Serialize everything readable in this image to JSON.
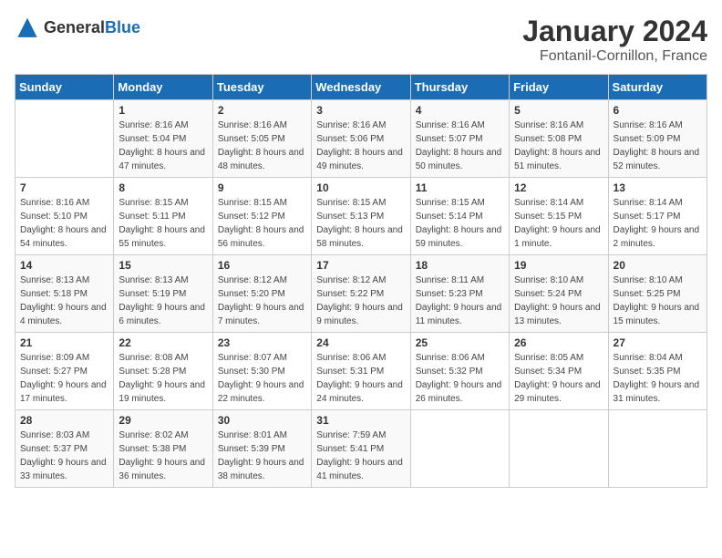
{
  "header": {
    "logo": {
      "general": "General",
      "blue": "Blue"
    },
    "title": "January 2024",
    "location": "Fontanil-Cornillon, France"
  },
  "weekdays": [
    "Sunday",
    "Monday",
    "Tuesday",
    "Wednesday",
    "Thursday",
    "Friday",
    "Saturday"
  ],
  "weeks": [
    [
      {
        "day": "",
        "sunrise": "",
        "sunset": "",
        "daylight": ""
      },
      {
        "day": "1",
        "sunrise": "Sunrise: 8:16 AM",
        "sunset": "Sunset: 5:04 PM",
        "daylight": "Daylight: 8 hours and 47 minutes."
      },
      {
        "day": "2",
        "sunrise": "Sunrise: 8:16 AM",
        "sunset": "Sunset: 5:05 PM",
        "daylight": "Daylight: 8 hours and 48 minutes."
      },
      {
        "day": "3",
        "sunrise": "Sunrise: 8:16 AM",
        "sunset": "Sunset: 5:06 PM",
        "daylight": "Daylight: 8 hours and 49 minutes."
      },
      {
        "day": "4",
        "sunrise": "Sunrise: 8:16 AM",
        "sunset": "Sunset: 5:07 PM",
        "daylight": "Daylight: 8 hours and 50 minutes."
      },
      {
        "day": "5",
        "sunrise": "Sunrise: 8:16 AM",
        "sunset": "Sunset: 5:08 PM",
        "daylight": "Daylight: 8 hours and 51 minutes."
      },
      {
        "day": "6",
        "sunrise": "Sunrise: 8:16 AM",
        "sunset": "Sunset: 5:09 PM",
        "daylight": "Daylight: 8 hours and 52 minutes."
      }
    ],
    [
      {
        "day": "7",
        "sunrise": "Sunrise: 8:16 AM",
        "sunset": "Sunset: 5:10 PM",
        "daylight": "Daylight: 8 hours and 54 minutes."
      },
      {
        "day": "8",
        "sunrise": "Sunrise: 8:15 AM",
        "sunset": "Sunset: 5:11 PM",
        "daylight": "Daylight: 8 hours and 55 minutes."
      },
      {
        "day": "9",
        "sunrise": "Sunrise: 8:15 AM",
        "sunset": "Sunset: 5:12 PM",
        "daylight": "Daylight: 8 hours and 56 minutes."
      },
      {
        "day": "10",
        "sunrise": "Sunrise: 8:15 AM",
        "sunset": "Sunset: 5:13 PM",
        "daylight": "Daylight: 8 hours and 58 minutes."
      },
      {
        "day": "11",
        "sunrise": "Sunrise: 8:15 AM",
        "sunset": "Sunset: 5:14 PM",
        "daylight": "Daylight: 8 hours and 59 minutes."
      },
      {
        "day": "12",
        "sunrise": "Sunrise: 8:14 AM",
        "sunset": "Sunset: 5:15 PM",
        "daylight": "Daylight: 9 hours and 1 minute."
      },
      {
        "day": "13",
        "sunrise": "Sunrise: 8:14 AM",
        "sunset": "Sunset: 5:17 PM",
        "daylight": "Daylight: 9 hours and 2 minutes."
      }
    ],
    [
      {
        "day": "14",
        "sunrise": "Sunrise: 8:13 AM",
        "sunset": "Sunset: 5:18 PM",
        "daylight": "Daylight: 9 hours and 4 minutes."
      },
      {
        "day": "15",
        "sunrise": "Sunrise: 8:13 AM",
        "sunset": "Sunset: 5:19 PM",
        "daylight": "Daylight: 9 hours and 6 minutes."
      },
      {
        "day": "16",
        "sunrise": "Sunrise: 8:12 AM",
        "sunset": "Sunset: 5:20 PM",
        "daylight": "Daylight: 9 hours and 7 minutes."
      },
      {
        "day": "17",
        "sunrise": "Sunrise: 8:12 AM",
        "sunset": "Sunset: 5:22 PM",
        "daylight": "Daylight: 9 hours and 9 minutes."
      },
      {
        "day": "18",
        "sunrise": "Sunrise: 8:11 AM",
        "sunset": "Sunset: 5:23 PM",
        "daylight": "Daylight: 9 hours and 11 minutes."
      },
      {
        "day": "19",
        "sunrise": "Sunrise: 8:10 AM",
        "sunset": "Sunset: 5:24 PM",
        "daylight": "Daylight: 9 hours and 13 minutes."
      },
      {
        "day": "20",
        "sunrise": "Sunrise: 8:10 AM",
        "sunset": "Sunset: 5:25 PM",
        "daylight": "Daylight: 9 hours and 15 minutes."
      }
    ],
    [
      {
        "day": "21",
        "sunrise": "Sunrise: 8:09 AM",
        "sunset": "Sunset: 5:27 PM",
        "daylight": "Daylight: 9 hours and 17 minutes."
      },
      {
        "day": "22",
        "sunrise": "Sunrise: 8:08 AM",
        "sunset": "Sunset: 5:28 PM",
        "daylight": "Daylight: 9 hours and 19 minutes."
      },
      {
        "day": "23",
        "sunrise": "Sunrise: 8:07 AM",
        "sunset": "Sunset: 5:30 PM",
        "daylight": "Daylight: 9 hours and 22 minutes."
      },
      {
        "day": "24",
        "sunrise": "Sunrise: 8:06 AM",
        "sunset": "Sunset: 5:31 PM",
        "daylight": "Daylight: 9 hours and 24 minutes."
      },
      {
        "day": "25",
        "sunrise": "Sunrise: 8:06 AM",
        "sunset": "Sunset: 5:32 PM",
        "daylight": "Daylight: 9 hours and 26 minutes."
      },
      {
        "day": "26",
        "sunrise": "Sunrise: 8:05 AM",
        "sunset": "Sunset: 5:34 PM",
        "daylight": "Daylight: 9 hours and 29 minutes."
      },
      {
        "day": "27",
        "sunrise": "Sunrise: 8:04 AM",
        "sunset": "Sunset: 5:35 PM",
        "daylight": "Daylight: 9 hours and 31 minutes."
      }
    ],
    [
      {
        "day": "28",
        "sunrise": "Sunrise: 8:03 AM",
        "sunset": "Sunset: 5:37 PM",
        "daylight": "Daylight: 9 hours and 33 minutes."
      },
      {
        "day": "29",
        "sunrise": "Sunrise: 8:02 AM",
        "sunset": "Sunset: 5:38 PM",
        "daylight": "Daylight: 9 hours and 36 minutes."
      },
      {
        "day": "30",
        "sunrise": "Sunrise: 8:01 AM",
        "sunset": "Sunset: 5:39 PM",
        "daylight": "Daylight: 9 hours and 38 minutes."
      },
      {
        "day": "31",
        "sunrise": "Sunrise: 7:59 AM",
        "sunset": "Sunset: 5:41 PM",
        "daylight": "Daylight: 9 hours and 41 minutes."
      },
      {
        "day": "",
        "sunrise": "",
        "sunset": "",
        "daylight": ""
      },
      {
        "day": "",
        "sunrise": "",
        "sunset": "",
        "daylight": ""
      },
      {
        "day": "",
        "sunrise": "",
        "sunset": "",
        "daylight": ""
      }
    ]
  ]
}
